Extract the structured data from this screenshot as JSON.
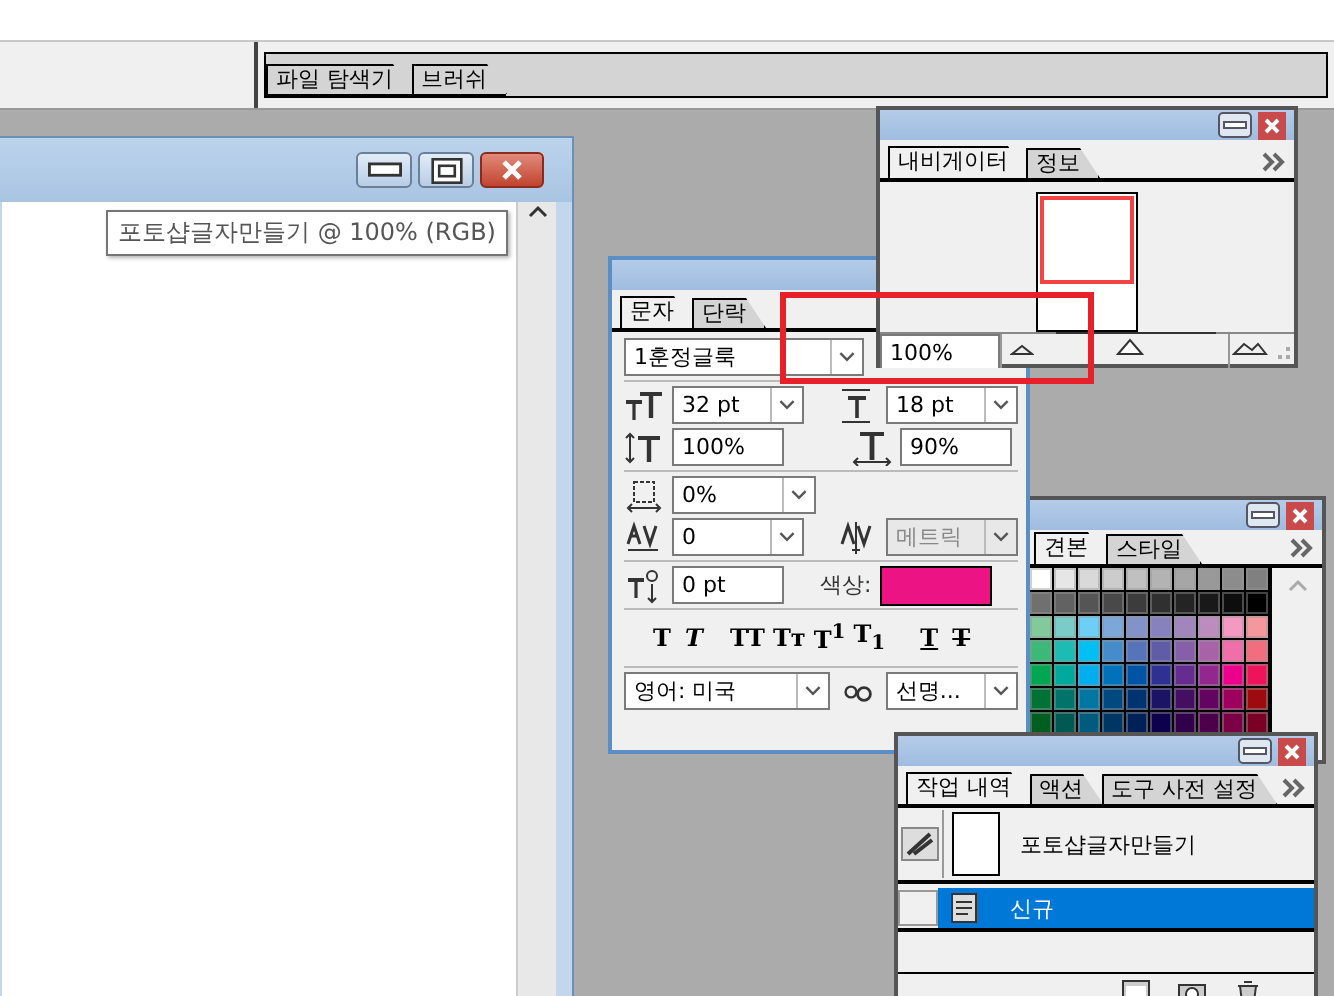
{
  "palette_well": {
    "tabs": [
      {
        "label": "파일 탐색기",
        "selected": false
      },
      {
        "label": "브러쉬",
        "selected": false
      }
    ]
  },
  "document_window": {
    "tooltip": "포토샵글자만들기 @ 100% (RGB)"
  },
  "swatches_panel": {
    "tabs": [
      {
        "label": "견본",
        "selected": true
      },
      {
        "label": "스타일",
        "selected": false
      }
    ],
    "swatches": [
      {
        "color": "#ffffff"
      },
      {
        "color": "#e6e6e6"
      },
      {
        "color": "#d9d9d9"
      },
      {
        "color": "#cccccc"
      },
      {
        "color": "#c0c0c0"
      },
      {
        "color": "#b3b3b3"
      },
      {
        "color": "#a6a6a6"
      },
      {
        "color": "#999999"
      },
      {
        "color": "#8c8c8c"
      },
      {
        "color": "#808080"
      },
      {
        "color": "#707070"
      },
      {
        "color": "#626262"
      },
      {
        "color": "#555555"
      },
      {
        "color": "#494949"
      },
      {
        "color": "#3c3c3c"
      },
      {
        "color": "#303030"
      },
      {
        "color": "#242424"
      },
      {
        "color": "#191919"
      },
      {
        "color": "#0d0d0d"
      },
      {
        "color": "#000000"
      },
      {
        "color": "#82ca9c"
      },
      {
        "color": "#7accc8"
      },
      {
        "color": "#6dcff6"
      },
      {
        "color": "#7da7d9"
      },
      {
        "color": "#8393ca"
      },
      {
        "color": "#8781bd"
      },
      {
        "color": "#a186be"
      },
      {
        "color": "#bd8cbf"
      },
      {
        "color": "#f49ac1"
      },
      {
        "color": "#f5989d"
      },
      {
        "color": "#3cb878"
      },
      {
        "color": "#1cbbb4"
      },
      {
        "color": "#00bff3"
      },
      {
        "color": "#448ccb"
      },
      {
        "color": "#5574b9"
      },
      {
        "color": "#605ca8"
      },
      {
        "color": "#8560a8"
      },
      {
        "color": "#a863a8"
      },
      {
        "color": "#f06ea9"
      },
      {
        "color": "#f26d7d"
      },
      {
        "color": "#00a651"
      },
      {
        "color": "#00a99d"
      },
      {
        "color": "#00aeef"
      },
      {
        "color": "#0072bc"
      },
      {
        "color": "#0054a6"
      },
      {
        "color": "#2e3192"
      },
      {
        "color": "#662d91"
      },
      {
        "color": "#92278f"
      },
      {
        "color": "#ec008c"
      },
      {
        "color": "#ed145b"
      },
      {
        "color": "#007236"
      },
      {
        "color": "#00746b"
      },
      {
        "color": "#0076a3"
      },
      {
        "color": "#004a80"
      },
      {
        "color": "#003471"
      },
      {
        "color": "#1b1464"
      },
      {
        "color": "#440e62"
      },
      {
        "color": "#630460"
      },
      {
        "color": "#9e005d"
      },
      {
        "color": "#9e0b0f"
      },
      {
        "color": "#005e20"
      },
      {
        "color": "#005952"
      },
      {
        "color": "#005b7f"
      },
      {
        "color": "#003663"
      },
      {
        "color": "#002157"
      },
      {
        "color": "#0d004c"
      },
      {
        "color": "#32004b"
      },
      {
        "color": "#4b0049"
      },
      {
        "color": "#7b0046"
      },
      {
        "color": "#7a0026"
      }
    ]
  },
  "character_panel": {
    "tabs": [
      {
        "label": "문자",
        "selected": true
      },
      {
        "label": "단락",
        "selected": false
      }
    ],
    "font_family": "1훈정글룩",
    "font_size": "32 pt",
    "leading": "18 pt",
    "vertical_scale": "100%",
    "horizontal_scale": "90%",
    "tsume": "0%",
    "tracking": "0",
    "kerning": {
      "value": "메트릭",
      "disabled": true
    },
    "baseline_shift": "0 pt",
    "color_label": "색상:",
    "color": "#ec1384",
    "style_buttons": [
      {
        "label": "T",
        "kind": "bold"
      },
      {
        "label": "T",
        "kind": "italic"
      },
      {
        "label": "TT",
        "kind": "caps"
      },
      {
        "label": "Tᴛ",
        "kind": "small-caps"
      },
      {
        "label": "T$^{1}$",
        "kind": "superscript"
      },
      {
        "label": "T$_{1}$",
        "kind": "subscript"
      },
      {
        "label": "T",
        "kind": "underline"
      },
      {
        "label": "T",
        "kind": "strikethrough"
      }
    ],
    "language": "영어: 미국",
    "antialias": "선명..."
  },
  "navigator_panel": {
    "tabs": [
      {
        "label": "내비게이터",
        "selected": true
      },
      {
        "label": "정보",
        "selected": false
      }
    ],
    "zoom": "100%",
    "zoom_slider": {
      "level": 0.47
    }
  },
  "history_panel": {
    "tabs": [
      {
        "label": "작업 내역",
        "selected": true
      },
      {
        "label": "액션",
        "selected": false
      },
      {
        "label": "도구 사전 설정",
        "selected": false
      }
    ],
    "snapshot": "포토샵글자만들기",
    "states": [
      {
        "label": "신규",
        "selected": true
      }
    ]
  }
}
